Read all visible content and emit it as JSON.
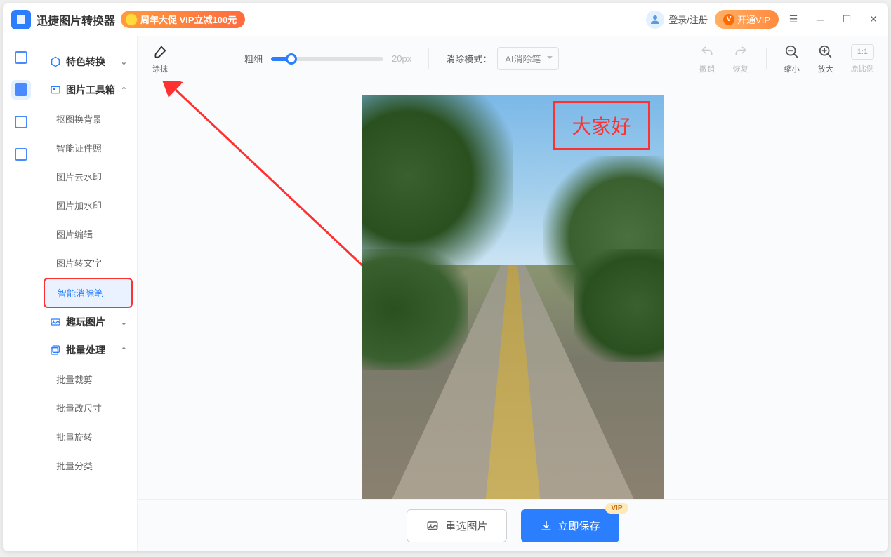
{
  "app": {
    "title": "迅捷图片转换器",
    "promo": "周年大促 VIP立减100元"
  },
  "titlebar": {
    "login": "登录/注册",
    "vip_button": "开通VIP"
  },
  "sidebar": {
    "groups": [
      {
        "label": "特色转换",
        "expanded": false
      },
      {
        "label": "图片工具箱",
        "expanded": true,
        "items": [
          "抠图换背景",
          "智能证件照",
          "图片去水印",
          "图片加水印",
          "图片编辑",
          "图片转文字",
          "智能消除笔"
        ],
        "active_index": 6
      },
      {
        "label": "趣玩图片",
        "expanded": false
      },
      {
        "label": "批量处理",
        "expanded": true,
        "items": [
          "批量裁剪",
          "批量改尺寸",
          "批量旋转",
          "批量分类"
        ]
      }
    ]
  },
  "toolbar": {
    "brush_label": "涂抹",
    "thickness_label": "粗细",
    "thickness_value": "20px",
    "mode_label": "消除模式：",
    "mode_value": "AI消除笔",
    "undo": "撤销",
    "redo": "恢复",
    "zoom_out": "缩小",
    "zoom_in": "放大",
    "ratio": "1:1",
    "ratio_label": "原比例"
  },
  "overlay": {
    "text": "大家好"
  },
  "bottom": {
    "reselect": "重选图片",
    "save": "立即保存",
    "vip_tag": "VIP"
  }
}
